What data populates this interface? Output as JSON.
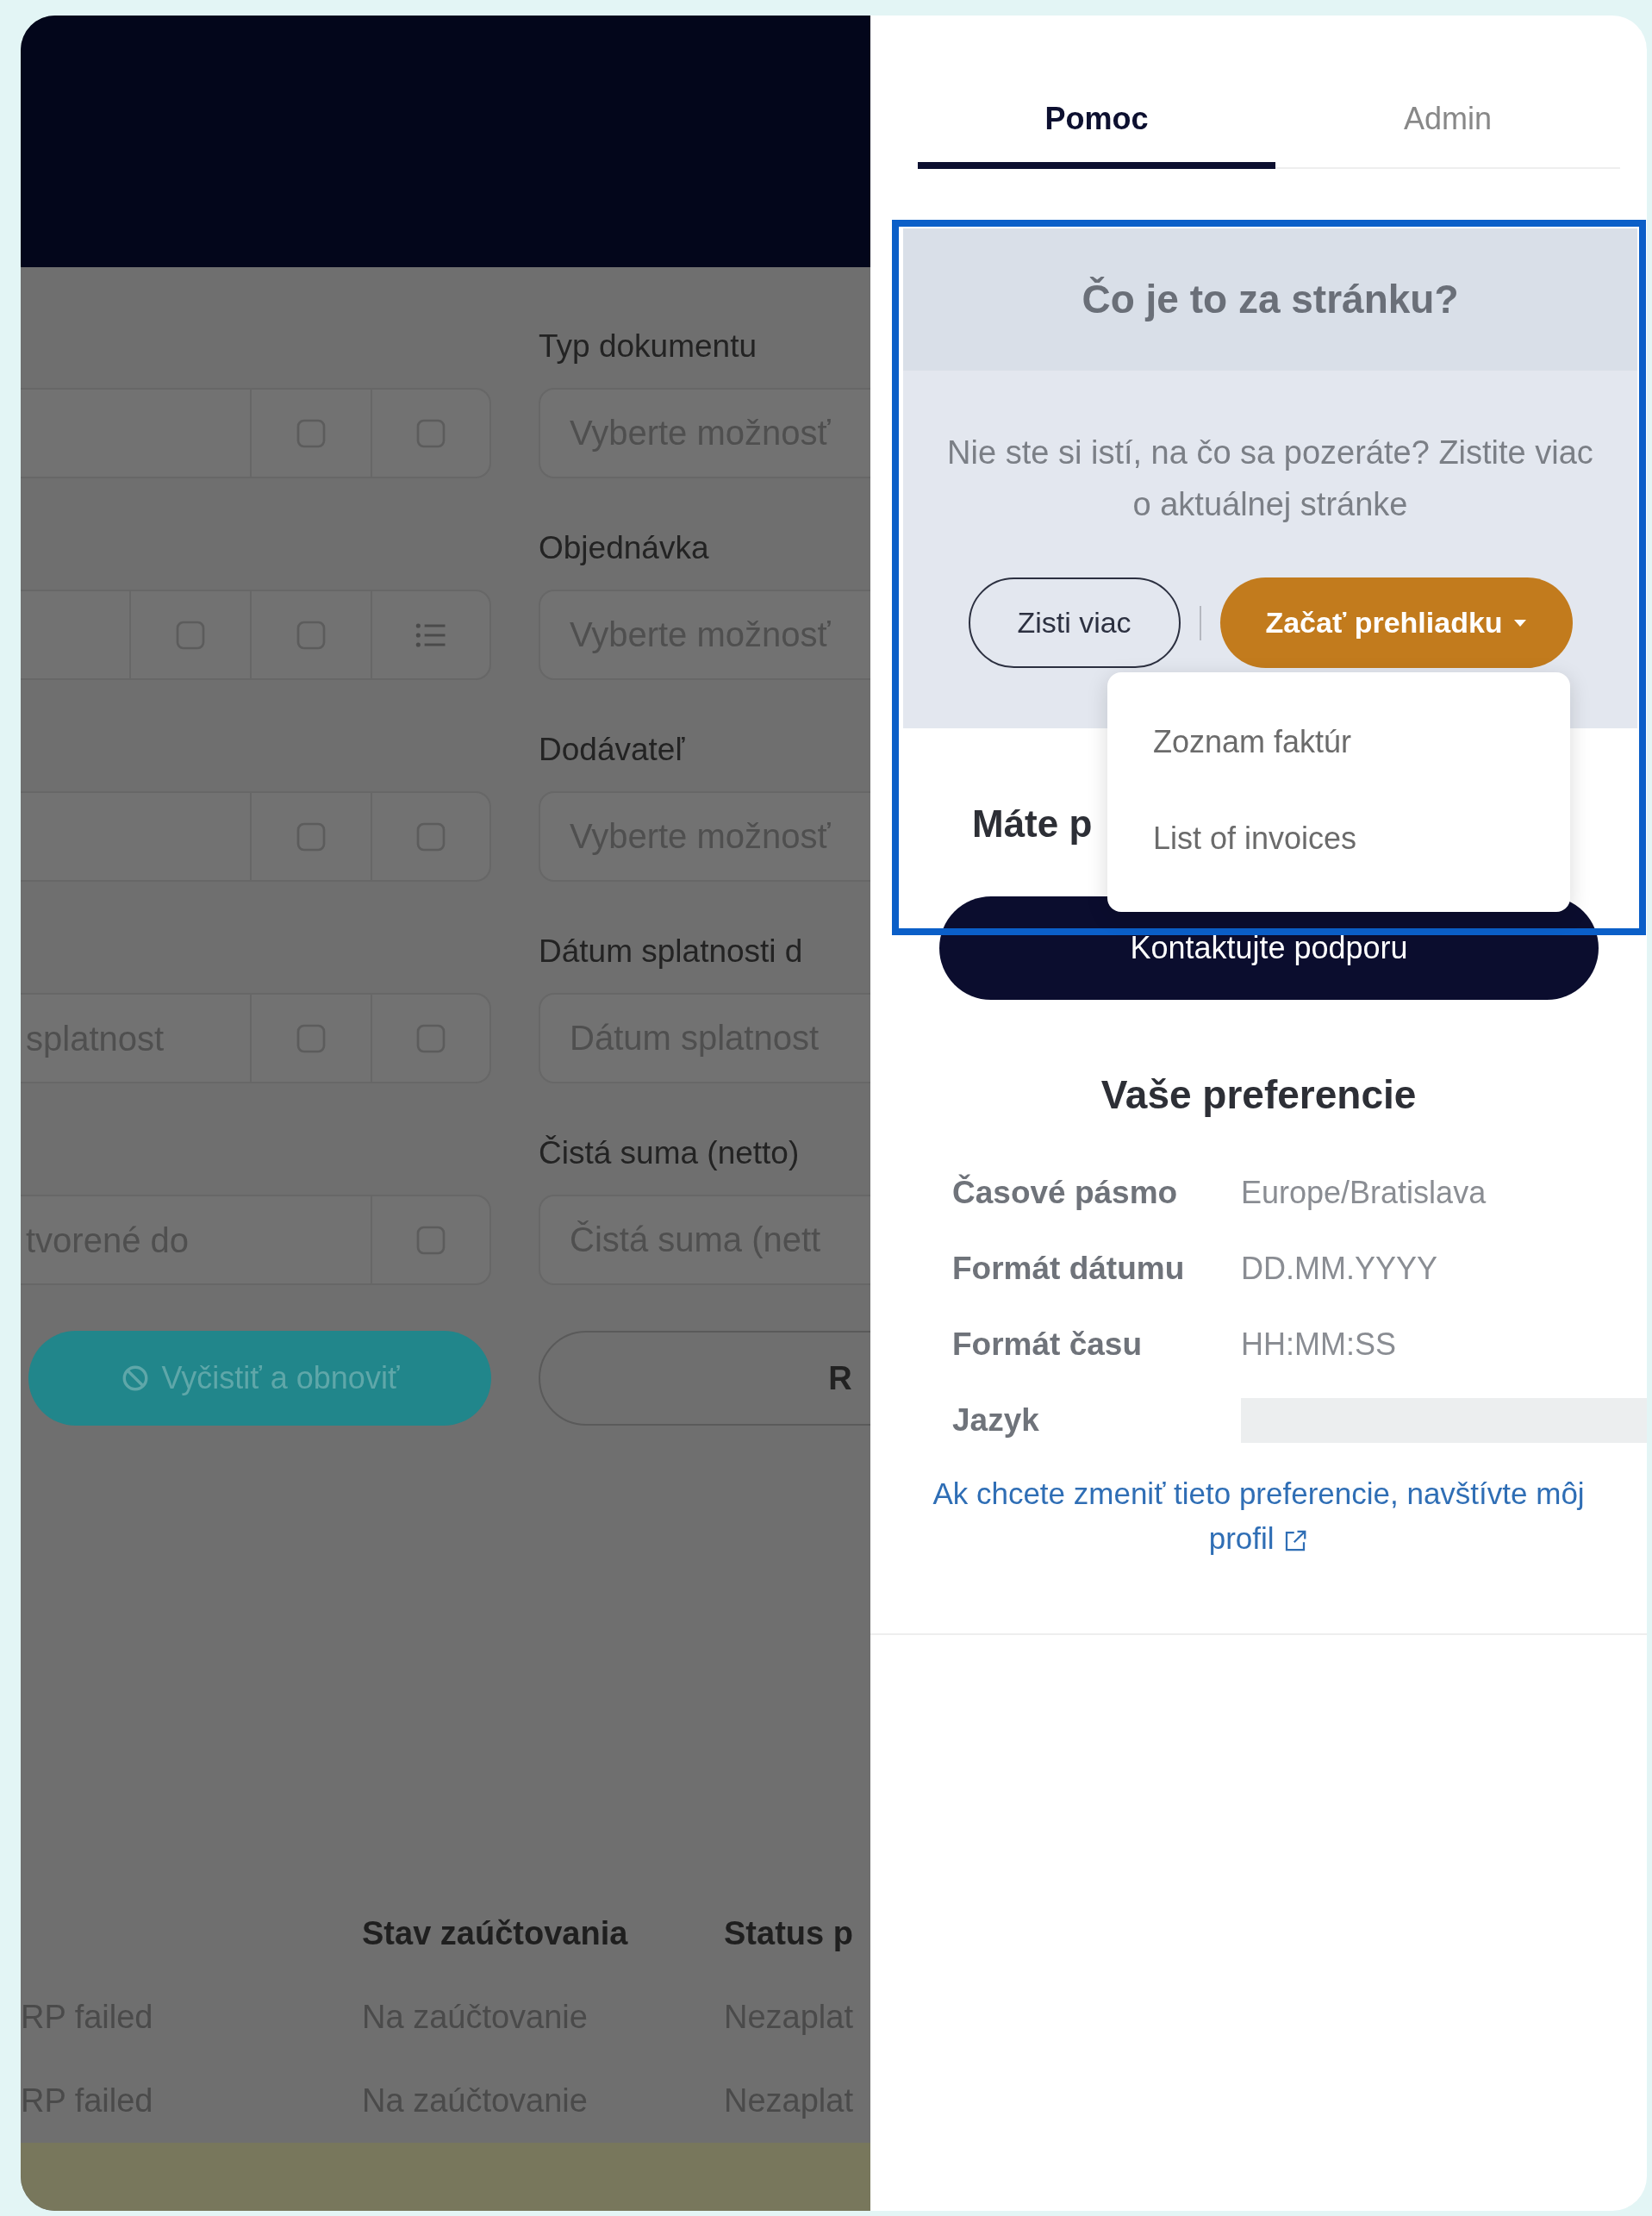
{
  "filter_rows": [
    {
      "left_cells": [
        {
          "kind": "square"
        },
        {
          "kind": "square"
        }
      ],
      "label": "Typ dokumentu",
      "placeholder": "Vyberte možnosť"
    },
    {
      "left_cells": [
        {
          "kind": "blank"
        },
        {
          "kind": "square"
        },
        {
          "kind": "square"
        },
        {
          "kind": "list"
        }
      ],
      "label": "Objednávka",
      "placeholder": "Vyberte možnosť"
    },
    {
      "left_cells": [
        {
          "kind": "square"
        },
        {
          "kind": "square"
        }
      ],
      "label": "Dodávateľ",
      "placeholder": "Vyberte možnosť"
    },
    {
      "left_placeholder": "splatnost",
      "left_cells": [
        {
          "kind": "square"
        },
        {
          "kind": "square"
        }
      ],
      "label": "Dátum splatnosti d",
      "placeholder": "Dátum splatnost"
    },
    {
      "left_placeholder": "tvorené do",
      "left_cells": [
        {
          "kind": "square"
        }
      ],
      "label": "Čistá suma (netto)",
      "placeholder": "Čistá suma (nett"
    }
  ],
  "clear_button": "Vyčistiť a obnoviť",
  "second_button": "R",
  "table": {
    "columns": [
      "Stav zaúčtovania",
      "Status p"
    ],
    "rows": [
      {
        "highlighted": false,
        "cells": [
          "RP failed",
          "Na zaúčtovanie",
          "Nezaplat"
        ]
      },
      {
        "highlighted": false,
        "cells": [
          "RP failed",
          "Na zaúčtovanie",
          "Nezaplat"
        ]
      },
      {
        "highlighted": true
      }
    ]
  },
  "tabs": [
    {
      "label": "Pomoc",
      "selected": true
    },
    {
      "label": "Admin",
      "selected": false
    }
  ],
  "page_help": {
    "title": "Čo je to za stránku?",
    "text": "Nie ste si istí, na čo sa pozeráte? Zistite viac o aktuálnej stránke",
    "learn_more": "Zisti viac",
    "tour_button": "Začať prehliadku",
    "tour_menu": {
      "expanded": true,
      "items": [
        "Zoznam faktúr",
        "List of invoices"
      ]
    }
  },
  "support": {
    "heading": "Máte p",
    "button": "Kontaktujte podporu"
  },
  "preferences": {
    "title": "Vaše preferencie",
    "rows": [
      {
        "label": "Časové pásmo",
        "value": "Europe/Bratislava"
      },
      {
        "label": "Formát dátumu",
        "value": "DD.MM.YYYY"
      },
      {
        "label": "Formát času",
        "value": "HH:MM:SS"
      },
      {
        "label": "Jazyk",
        "redacted": true
      }
    ],
    "link": "Ak chcete zmeniť tieto preferencie, navštívte môj profil"
  }
}
